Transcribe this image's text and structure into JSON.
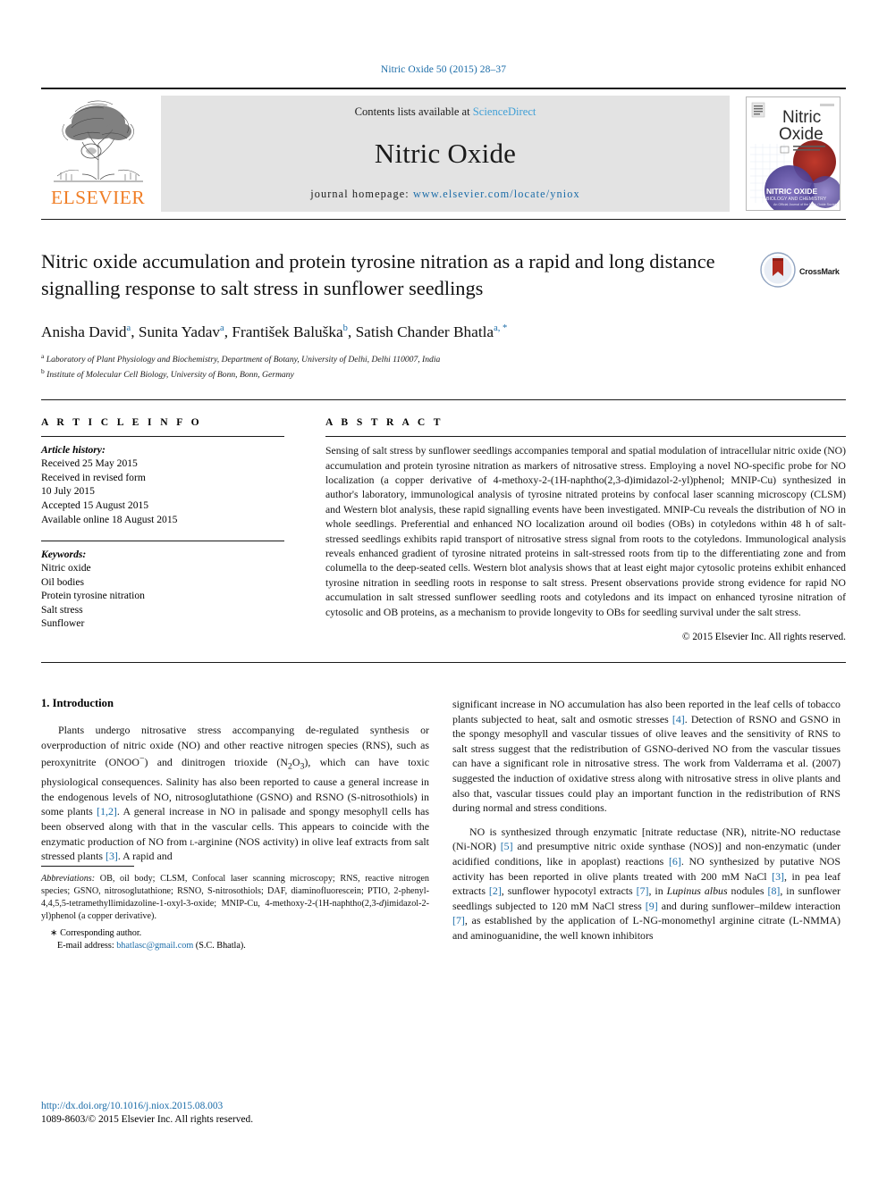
{
  "running_head": "Nitric Oxide 50 (2015) 28–37",
  "banner": {
    "publisher": "ELSEVIER",
    "contents_prefix": "Contents lists available at ",
    "contents_link": "ScienceDirect",
    "journal_name": "Nitric Oxide",
    "homepage_prefix": "journal homepage: ",
    "homepage_url": "www.elsevier.com/locate/yniox",
    "cover_title_line1": "Nitric",
    "cover_title_line2": "Oxide",
    "cover_band_line1": "NITRIC OXIDE",
    "cover_band_line2": "BIOLOGY AND CHEMISTRY"
  },
  "article": {
    "title": "Nitric oxide accumulation and protein tyrosine nitration as a rapid and long distance signalling response to salt stress in sunflower seedlings",
    "crossmark_label": "CrossMark",
    "authors": [
      {
        "name": "Anisha David",
        "marks": "a"
      },
      {
        "name": "Sunita Yadav",
        "marks": "a"
      },
      {
        "name": "František Baluška",
        "marks": "b"
      },
      {
        "name": "Satish Chander Bhatla",
        "marks": "a, *"
      }
    ],
    "affiliations": [
      {
        "mark": "a",
        "text": "Laboratory of Plant Physiology and Biochemistry, Department of Botany, University of Delhi, Delhi 110007, India"
      },
      {
        "mark": "b",
        "text": "Institute of Molecular Cell Biology, University of Bonn, Bonn, Germany"
      }
    ]
  },
  "article_info": {
    "heading": "A R T I C L E  I N F O",
    "history_title": "Article history:",
    "history": [
      "Received 25 May 2015",
      "Received in revised form",
      "10 July 2015",
      "Accepted 15 August 2015",
      "Available online 18 August 2015"
    ],
    "keywords_title": "Keywords:",
    "keywords": [
      "Nitric oxide",
      "Oil bodies",
      "Protein tyrosine nitration",
      "Salt stress",
      "Sunflower"
    ]
  },
  "abstract": {
    "heading": "A B S T R A C T",
    "text": "Sensing of salt stress by sunflower seedlings accompanies temporal and spatial modulation of intracellular nitric oxide (NO) accumulation and protein tyrosine nitration as markers of nitrosative stress. Employing a novel NO-specific probe for NO localization (a copper derivative of 4-methoxy-2-(1H-naphtho(2,3-d)imidazol-2-yl)phenol; MNIP-Cu) synthesized in author's laboratory, immunological analysis of tyrosine nitrated proteins by confocal laser scanning microscopy (CLSM) and Western blot analysis, these rapid signalling events have been investigated. MNIP-Cu reveals the distribution of NO in whole seedlings. Preferential and enhanced NO localization around oil bodies (OBs) in cotyledons within 48 h of salt-stressed seedlings exhibits rapid transport of nitrosative stress signal from roots to the cotyledons. Immunological analysis reveals enhanced gradient of tyrosine nitrated proteins in salt-stressed roots from tip to the differentiating zone and from columella to the deep-seated cells. Western blot analysis shows that at least eight major cytosolic proteins exhibit enhanced tyrosine nitration in seedling roots in response to salt stress. Present observations provide strong evidence for rapid NO accumulation in salt stressed sunflower seedling roots and cotyledons and its impact on enhanced tyrosine nitration of cytosolic and OB proteins, as a mechanism to provide longevity to OBs for seedling survival under the salt stress.",
    "copyright": "© 2015 Elsevier Inc. All rights reserved."
  },
  "body": {
    "section_heading": "1.  Introduction",
    "left_paragraph_1_a": "Plants undergo nitrosative stress accompanying de-regulated synthesis or overproduction of nitric oxide (NO) and other reactive nitrogen species (RNS), such as peroxynitrite (ONOO",
    "left_paragraph_1_b": ") and dinitrogen trioxide (N",
    "left_paragraph_1_c": "O",
    "left_paragraph_1_d": "), which can have toxic physiological consequences. Salinity has also been reported to cause a general increase in the endogenous levels of NO, nitrosoglutathione (GSNO) and RSNO (S-nitrosothiols) in some plants ",
    "left_ref_12": "[1,2]",
    "left_paragraph_1_e": ". A general increase in NO in palisade and spongy mesophyll cells has been observed along with that in the vascular cells. This appears to coincide with the enzymatic production of NO from ",
    "left_larginine": "l",
    "left_paragraph_1_f": "-arginine (NOS activity) in olive leaf extracts from salt stressed plants ",
    "left_ref_3": "[3]",
    "left_paragraph_1_g": ". A rapid and",
    "right_paragraph_1_a": "significant increase in NO accumulation has also been reported in the leaf cells of tobacco plants subjected to heat, salt and osmotic stresses ",
    "right_ref_4": "[4]",
    "right_paragraph_1_b": ". Detection of RSNO and GSNO in the spongy mesophyll and vascular tissues of olive leaves and the sensitivity of RNS to salt stress suggest that the redistribution of GSNO-derived NO from the vascular tissues can have a significant role in nitrosative stress. The work from Valderrama et al. (2007) suggested the induction of oxidative stress along with nitrosative stress in olive plants and also that, vascular tissues could play an important function in the redistribution of RNS during normal and stress conditions.",
    "right_paragraph_2_a": "NO is synthesized through enzymatic [nitrate reductase (NR), nitrite-NO reductase (Ni-NOR) ",
    "right_ref_5": "[5]",
    "right_paragraph_2_b": " and presumptive nitric oxide synthase (NOS)] and non-enzymatic (under acidified conditions, like in apoplast) reactions ",
    "right_ref_6": "[6]",
    "right_paragraph_2_c": ". NO synthesized by putative NOS activity has been reported in olive plants treated with 200 mM NaCl ",
    "right_ref_3": "[3]",
    "right_paragraph_2_d": ", in pea leaf extracts ",
    "right_ref_2": "[2]",
    "right_paragraph_2_e": ", sunflower hypocotyl extracts ",
    "right_ref_7": "[7]",
    "right_paragraph_2_f": ", in ",
    "right_lupinus": "Lupinus albus",
    "right_paragraph_2_g": " nodules ",
    "right_ref_8": "[8]",
    "right_paragraph_2_h": ", in sunflower seedlings subjected to 120 mM NaCl stress ",
    "right_ref_9": "[9]",
    "right_paragraph_2_i": " and during sunflower–mildew interaction ",
    "right_ref_7b": "[7]",
    "right_paragraph_2_j": ", as established by the application of L-NG-monomethyl arginine citrate (L-NMMA) and aminoguanidine, the well known inhibitors"
  },
  "footnotes": {
    "abbreviations_label": "Abbreviations:",
    "abbreviations_text": " OB, oil body; CLSM, Confocal laser scanning microscopy; RNS, reactive nitrogen species; GSNO, nitrosoglutathione; RSNO, S-nitrosothiols; DAF, diaminofluorescein; PTIO, 2-phenyl-4,4,5,5-tetramethyllimidazoline-1-oxyl-3-oxide; MNIP-Cu, 4-methoxy-2-(1H-naphtho(2,3-",
    "abbreviations_italic": "d",
    "abbreviations_text2": ")imidazol-2-yl)phenol (a copper derivative).",
    "corresponding": "∗ Corresponding author.",
    "email_label": "E-mail address:",
    "email": "bhatlasc@gmail.com",
    "email_suffix": " (S.C. Bhatla)."
  },
  "footer": {
    "doi": "http://dx.doi.org/10.1016/j.niox.2015.08.003",
    "issn_line": "1089-8603/© 2015 Elsevier Inc. All rights reserved."
  },
  "colors": {
    "link_blue": "#1b6ca8",
    "sciencedirect_blue": "#3f9fd6",
    "elsevier_orange": "#f07e26"
  }
}
